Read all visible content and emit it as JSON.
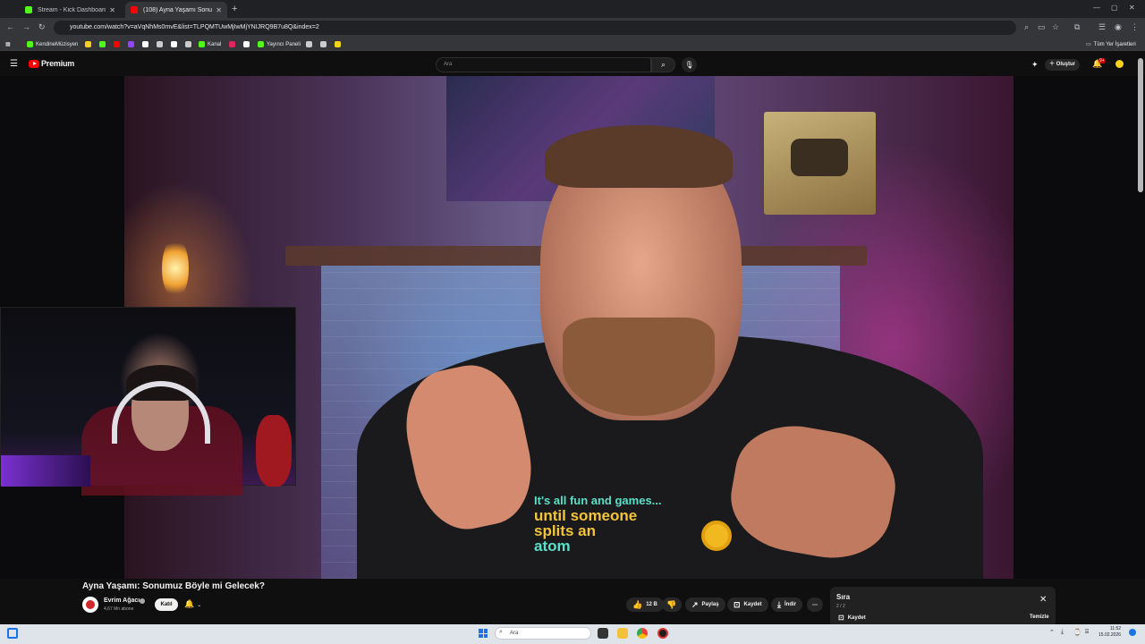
{
  "browser": {
    "tabs": [
      {
        "title": "Stream - Kick Dashboard",
        "favicon_color": "#53fc18",
        "active": false
      },
      {
        "title": "(108) Ayna Yaşamı Sonum...",
        "favicon_color": "#ff0000",
        "active": true
      }
    ],
    "url": "youtube.com/watch?v=aVqNhMs0mvE&list=TLPQMTUwMjIwMjYNIJRQ9B7u8Q&index=2",
    "bookmarks": [
      {
        "label": "KendineMüzisyen",
        "color": "#53fc18"
      },
      {
        "label": "",
        "color": "#f7d21b"
      },
      {
        "label": "",
        "color": "#53fc18"
      },
      {
        "label": "",
        "color": "#ff0000"
      },
      {
        "label": "",
        "color": "#9146ff"
      },
      {
        "label": "",
        "color": "#ffffff"
      },
      {
        "label": "",
        "color": "#cccccc"
      },
      {
        "label": "",
        "color": "#ffffff"
      },
      {
        "label": "",
        "color": "#cccccc"
      },
      {
        "label": "Kanal",
        "color": "#53fc18"
      },
      {
        "label": "",
        "color": "#e0245e"
      },
      {
        "label": "",
        "color": "#ffffff"
      },
      {
        "label": "Yayıncı Paneli",
        "color": "#53fc18"
      },
      {
        "label": "",
        "color": "#cccccc"
      },
      {
        "label": "",
        "color": "#cccccc"
      },
      {
        "label": "",
        "color": "#f7d21b"
      }
    ],
    "all_bookmarks_label": "Tüm Yer İşaretleri"
  },
  "youtube": {
    "brand": "Premium",
    "search_placeholder": "Ara",
    "create_label": "Oluştur",
    "notification_count": "9+"
  },
  "video": {
    "shirt_text": [
      "It's all fun and games...",
      "until someone",
      "splits an",
      "atom"
    ],
    "title": "Ayna Yaşamı: Sonumuz Böyle mi Gelecek?",
    "channel_name": "Evrim Ağacı",
    "subscribers": "4,67 Mn abone",
    "join_label": "Katıl",
    "like_count": "12 B",
    "share_label": "Paylaş",
    "save_label": "Kaydet",
    "download_label": "İndir"
  },
  "queue": {
    "title": "Sıra",
    "position": "2 / 2",
    "save_label": "Kaydet",
    "clear_label": "Temizle"
  },
  "taskbar": {
    "search_placeholder": "Ara",
    "time": "11:52",
    "date": "15.02.2026"
  },
  "icons": {
    "accent": "#ff0000",
    "kick": "#53fc18"
  }
}
